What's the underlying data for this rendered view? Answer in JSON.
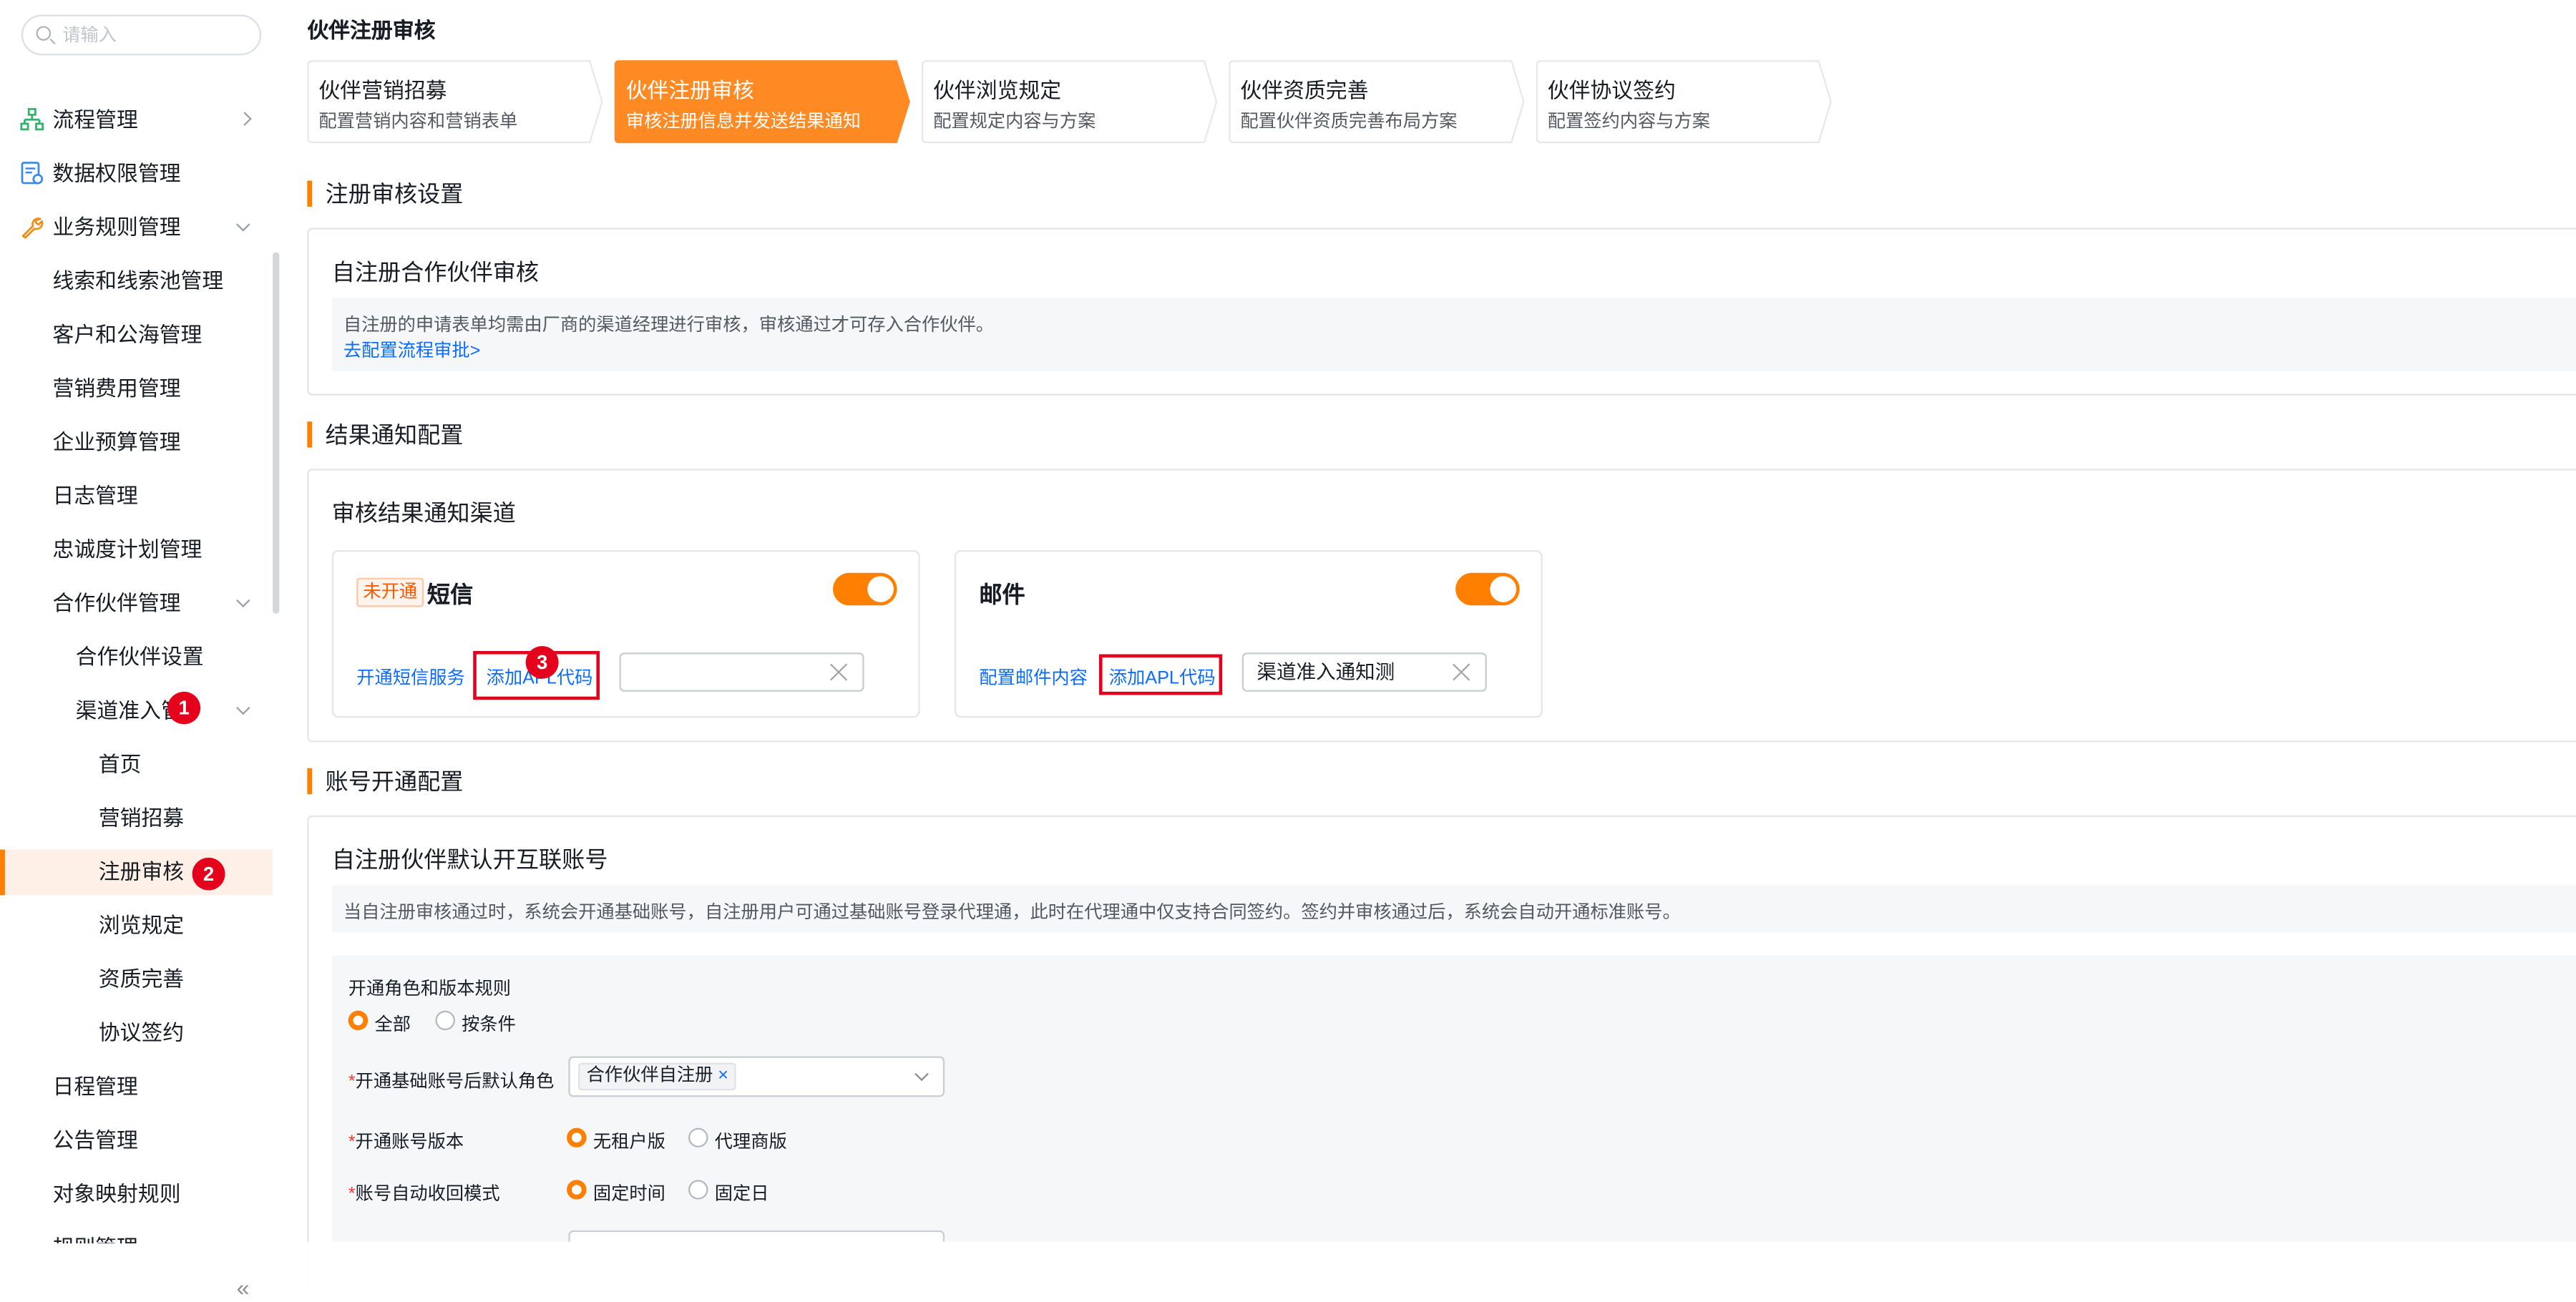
{
  "search": {
    "placeholder": "请输入"
  },
  "sidebar": {
    "items": [
      {
        "label": "流程管理"
      },
      {
        "label": "数据权限管理"
      },
      {
        "label": "业务规则管理"
      },
      {
        "label": "线索和线索池管理"
      },
      {
        "label": "客户和公海管理"
      },
      {
        "label": "营销费用管理"
      },
      {
        "label": "企业预算管理"
      },
      {
        "label": "日志管理"
      },
      {
        "label": "忠诚度计划管理"
      },
      {
        "label": "合作伙伴管理"
      },
      {
        "label": "合作伙伴设置"
      },
      {
        "label": "渠道准入管"
      },
      {
        "label": "首页"
      },
      {
        "label": "营销招募"
      },
      {
        "label": "注册审核"
      },
      {
        "label": "浏览规定"
      },
      {
        "label": "资质完善"
      },
      {
        "label": "协议签约"
      },
      {
        "label": "日程管理"
      },
      {
        "label": "公告管理"
      },
      {
        "label": "对象映射规则"
      },
      {
        "label": "规则管理"
      }
    ],
    "collapse_glyph": "«"
  },
  "badges": {
    "b1": "1",
    "b2": "2",
    "b3": "3"
  },
  "page_title": "伙伴注册审核",
  "steps": [
    {
      "title": "伙伴营销招募",
      "desc": "配置营销内容和营销表单"
    },
    {
      "title": "伙伴注册审核",
      "desc": "审核注册信息并发送结果通知"
    },
    {
      "title": "伙伴浏览规定",
      "desc": "配置规定内容与方案"
    },
    {
      "title": "伙伴资质完善",
      "desc": "配置伙伴资质完善布局方案"
    },
    {
      "title": "伙伴协议签约",
      "desc": "配置签约内容与方案"
    }
  ],
  "sections": {
    "review": {
      "title": "注册审核设置",
      "card_title": "自注册合作伙伴审核",
      "desc": "自注册的申请表单均需由厂商的渠道经理进行审核，审核通过才可存入合作伙伴。",
      "link": "去配置流程审批>"
    },
    "notify": {
      "title": "结果通知配置",
      "card_title": "审核结果通知渠道",
      "sms": {
        "tag": "未开通",
        "name": "短信",
        "enable_link": "开通短信服务",
        "apl_link": "添加APL代码",
        "input_value": ""
      },
      "email": {
        "name": "邮件",
        "config_link": "配置邮件内容",
        "apl_link": "添加APL代码",
        "input_value": "渠道准入通知测"
      }
    },
    "account": {
      "title": "账号开通配置",
      "card_title": "自注册伙伴默认开互联账号",
      "desc": "当自注册审核通过时，系统会开通基础账号，自注册用户可通过基础账号登录代理通，此时在代理通中仅支持合同签约。签约并审核通过后，系统会自动开通标准账号。",
      "rule_label": "开通角色和版本规则",
      "rule_options": [
        "全部",
        "按条件"
      ],
      "role_label": "开通基础账号后默认角色",
      "role_chip": "合作伙伴自注册",
      "version_label": "开通账号版本",
      "version_options": [
        "无租户版",
        "代理商版"
      ],
      "recycle_label": "账号自动收回模式",
      "recycle_options": [
        "固定时间",
        "固定日"
      ],
      "required_mark": "*"
    }
  },
  "colors": {
    "accent": "#ff8000",
    "link": "#0c6cff",
    "badge": "#e5001c"
  }
}
